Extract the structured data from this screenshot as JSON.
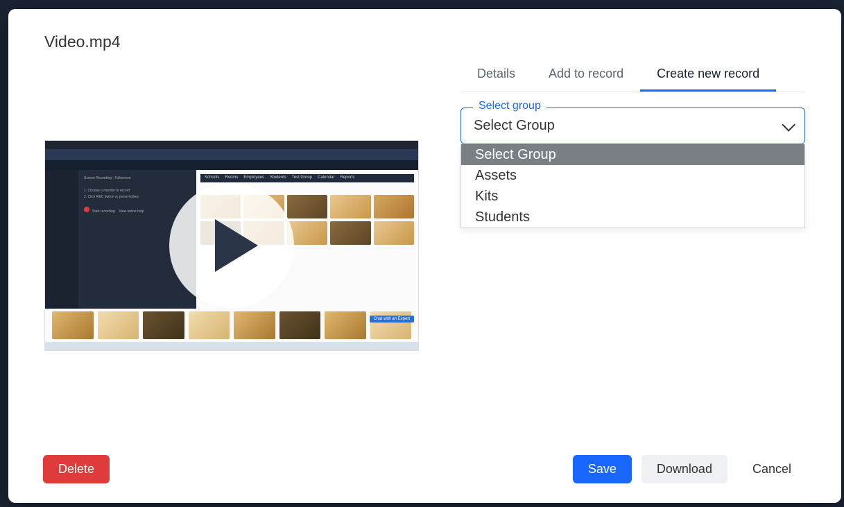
{
  "modal": {
    "title": "Video.mp4"
  },
  "tabs": {
    "details": "Details",
    "add_to_record": "Add to record",
    "create_new_record": "Create new record"
  },
  "select_group": {
    "label": "Select group",
    "value": "Select Group",
    "options": {
      "placeholder": "Select Group",
      "assets": "Assets",
      "kits": "Kits",
      "students": "Students"
    }
  },
  "footer": {
    "delete": "Delete",
    "save": "Save",
    "download": "Download",
    "cancel": "Cancel"
  },
  "thumb": {
    "nav": [
      "Schools",
      "Rooms",
      "Employees",
      "Students",
      "Test Group",
      "Calendar",
      "Reports"
    ]
  }
}
